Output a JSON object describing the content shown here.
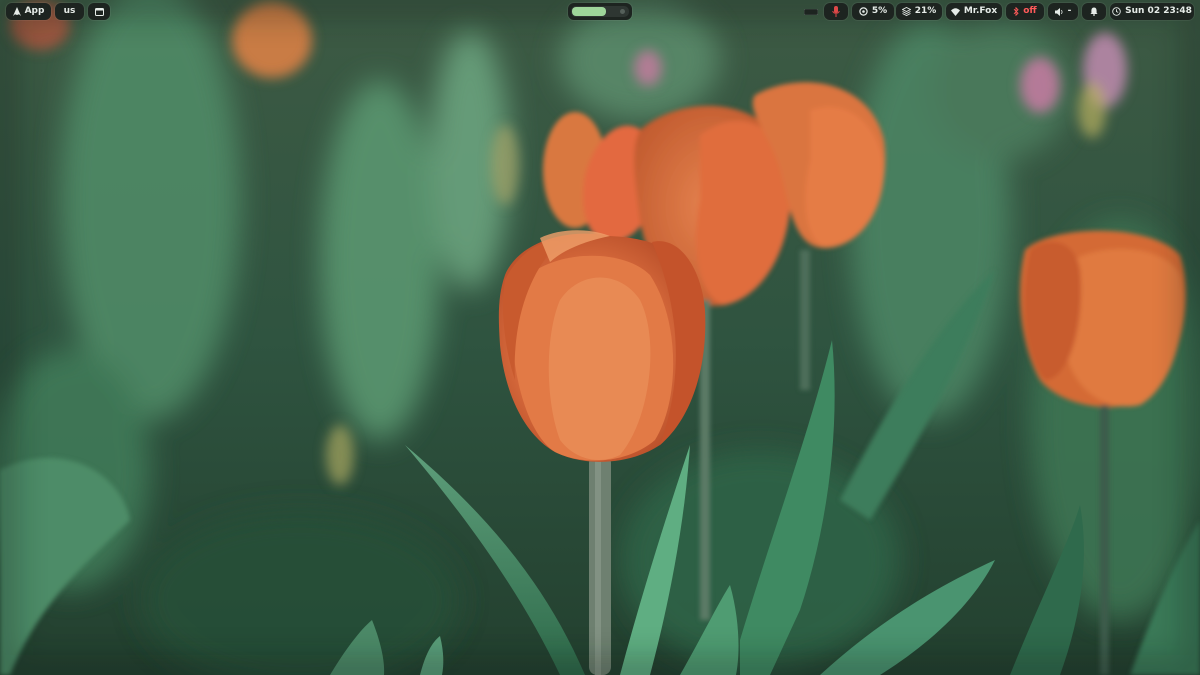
{
  "topbar": {
    "launcher": {
      "icon": "arch-logo-icon",
      "label": "App"
    },
    "keyboard_layout": {
      "label": "us"
    },
    "window_toggle": {
      "icon": "window-icon"
    },
    "workspaces": {
      "active": 1,
      "count": 2
    },
    "tray": {
      "indicator": {
        "icon": "small-rect-icon"
      },
      "microphone": {
        "icon": "mic-muted-icon",
        "color": "#e04848"
      },
      "cpu": {
        "icon": "cpu-icon",
        "value": "5%"
      },
      "memory": {
        "icon": "memory-icon",
        "value": "21%"
      },
      "network": {
        "icon": "wifi-icon",
        "ssid": "Mr.Fox"
      },
      "bluetooth": {
        "icon": "bluetooth-icon",
        "state": "off",
        "color": "#ff5a5a"
      },
      "volume": {
        "icon": "volume-icon",
        "level": "-"
      },
      "notifications": {
        "icon": "bell-icon"
      },
      "clock": {
        "icon": "clock-icon",
        "text": "Sun 02 23:48"
      }
    }
  },
  "wallpaper": {
    "subject": "orange-tulips-photo"
  },
  "colors": {
    "bar_bg": "#1d2420",
    "bar_fg": "#e6ece8",
    "workspace_active": "#9ed69a",
    "alert": "#e04848"
  }
}
